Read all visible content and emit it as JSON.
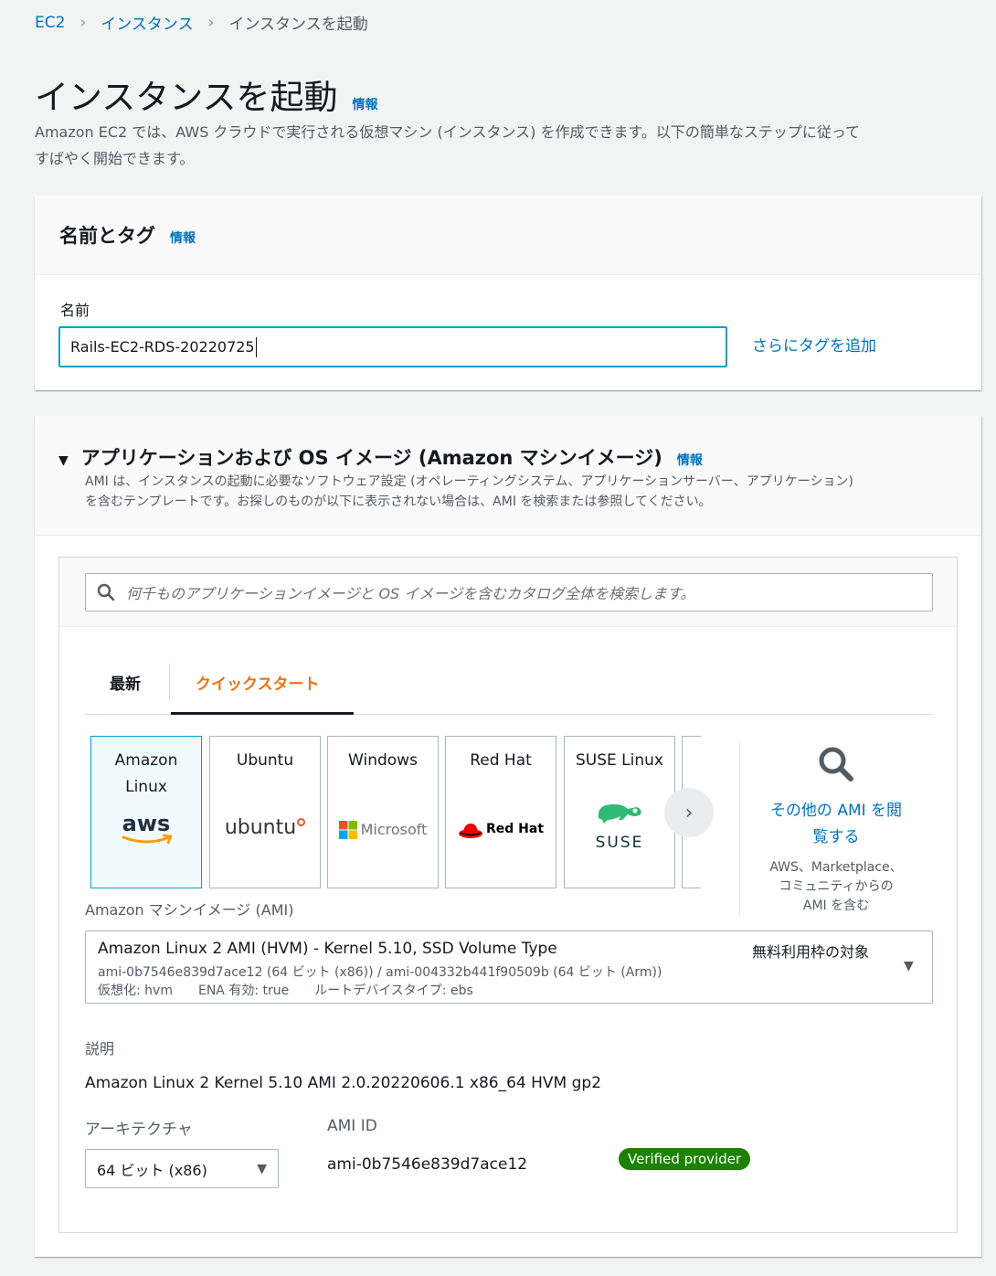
{
  "breadcrumb": {
    "items": [
      "EC2",
      "インスタンス"
    ],
    "current": "インスタンスを起動"
  },
  "page": {
    "title": "インスタンスを起動",
    "info": "情報",
    "intro_line1": "Amazon EC2 では、AWS クラウドで実行される仮想マシン (インスタンス) を作成できます。以下の簡単なステップに従って",
    "intro_line2": "すばやく開始できます。"
  },
  "name_section": {
    "title": "名前とタグ",
    "info": "情報",
    "name_label": "名前",
    "name_value": "Rails-EC2-RDS-20220725",
    "add_tags": "さらにタグを追加"
  },
  "ami_section": {
    "title": "アプリケーションおよび OS イメージ (Amazon マシンイメージ)",
    "info": "情報",
    "desc_line1": "AMI は、インスタンスの起動に必要なソフトウェア設定 (オペレーティングシステム、アプリケーションサーバー、アプリケーション)",
    "desc_line2": "を含むテンプレートです。お探しのものが以下に表示されない場合は、AMI を検索または参照してください。",
    "search_placeholder": "何千ものアプリケーションイメージと OS イメージを含むカタログ全体を検索します。",
    "tabs": {
      "recent": "最新",
      "quickstart": "クイックスタート"
    },
    "tiles": [
      {
        "line1": "Amazon",
        "line2": "Linux",
        "logo": "aws"
      },
      {
        "line1": "Ubuntu",
        "logo": "ubuntu"
      },
      {
        "line1": "Windows",
        "logo": "Microsoft"
      },
      {
        "line1": "Red Hat",
        "logo": "Red Hat"
      },
      {
        "line1": "SUSE Linux",
        "logo": "SUSE"
      }
    ],
    "browse_line1": "その他の AMI を閲",
    "browse_line2": "覧する",
    "browse_sub1": "AWS、Marketplace、",
    "browse_sub2": "コミュニティからの",
    "browse_sub3": "AMI を含む",
    "ami_label": "Amazon マシンイメージ (AMI)",
    "ami_name": "Amazon Linux 2 AMI (HVM) - Kernel 5.10, SSD Volume Type",
    "ami_ids": "ami-0b7546e839d7ace12 (64 ビット (x86)) / ami-004332b441f90509b (64 ビット (Arm))",
    "ami_virt": "仮想化: hvm",
    "ami_ena": "ENA 有効: true",
    "ami_root": "ルートデバイスタイプ: ebs",
    "free_tier": "無料利用枠の対象",
    "desc_label": "説明",
    "desc_value": "Amazon Linux 2 Kernel 5.10 AMI 2.0.20220606.1 x86_64 HVM gp2",
    "arch_label": "アーキテクチャ",
    "arch_value": "64 ビット (x86)",
    "amiid_label": "AMI ID",
    "amiid_value": "ami-0b7546e839d7ace12",
    "verified": "Verified provider"
  },
  "colors": {
    "link": "#0073bb",
    "accent": "#ec7211",
    "focus": "#00a1c9",
    "verified": "#1d8102"
  }
}
